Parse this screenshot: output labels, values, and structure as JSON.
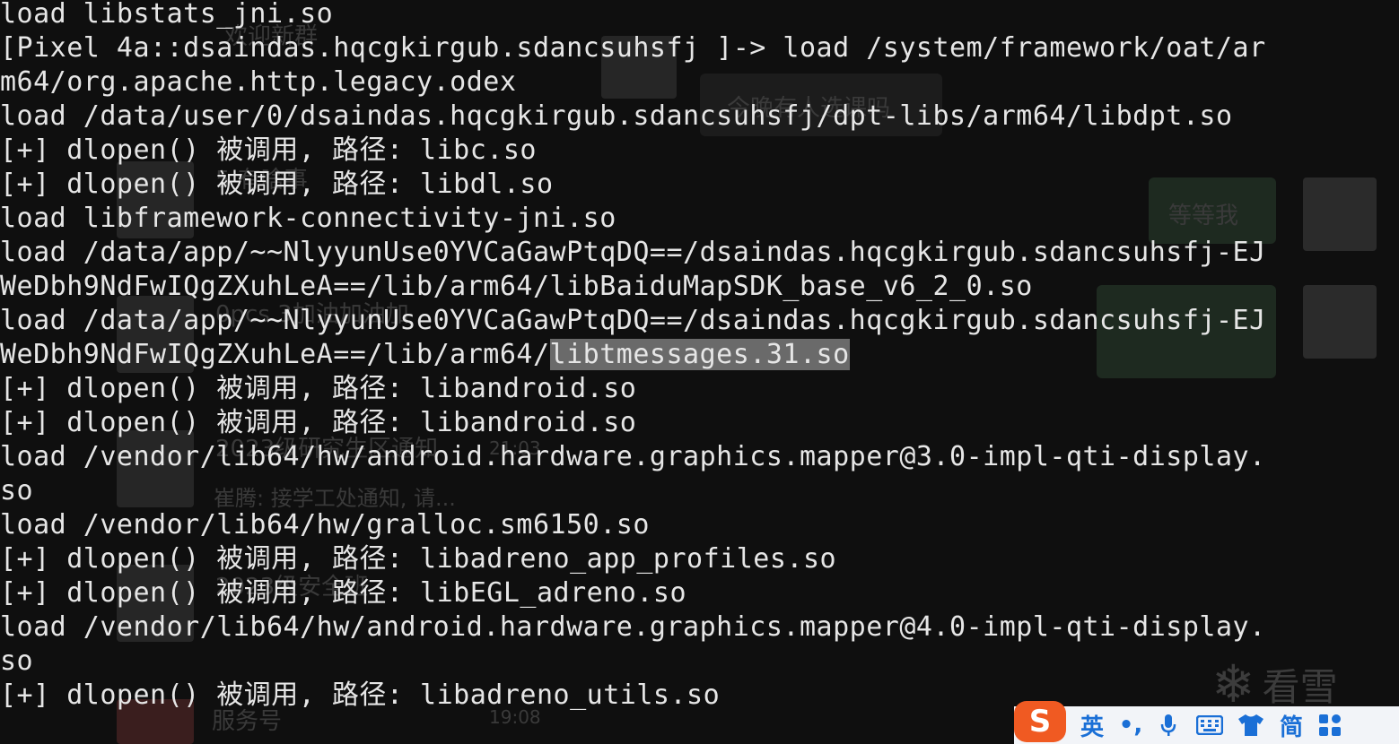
{
  "terminal": {
    "lines": [
      "load libstats_jni.so",
      "[Pixel 4a::dsaindas.hqcgkirgub.sdancsuhsfj ]-> load /system/framework/oat/ar",
      "m64/org.apache.http.legacy.odex",
      "load /data/user/0/dsaindas.hqcgkirgub.sdancsuhsfj/dpt-libs/arm64/libdpt.so",
      "[+] dlopen() 被调用, 路径: libc.so",
      "[+] dlopen() 被调用, 路径: libdl.so",
      "load libframework-connectivity-jni.so",
      "load /data/app/~~NlyyunUse0YVCaGawPtqDQ==/dsaindas.hqcgkirgub.sdancsuhsfj-EJ",
      "WeDbh9NdFwIQgZXuhLeA==/lib/arm64/libBaiduMapSDK_base_v6_2_0.so",
      "load /data/app/~~NlyyunUse0YVCaGawPtqDQ==/dsaindas.hqcgkirgub.sdancsuhsfj-EJ",
      "WeDbh9NdFwIQgZXuhLeA==/lib/arm64/",
      "[+] dlopen() 被调用, 路径: libandroid.so",
      "[+] dlopen() 被调用, 路径: libandroid.so",
      "load /vendor/lib64/hw/android.hardware.graphics.mapper@3.0-impl-qti-display.",
      "so",
      "load /vendor/lib64/hw/gralloc.sm6150.so",
      "[+] dlopen() 被调用, 路径: libadreno_app_profiles.so",
      "[+] dlopen() 被调用, 路径: libEGL_adreno.so",
      "load /vendor/lib64/hw/android.hardware.graphics.mapper@4.0-impl-qti-display.",
      "so",
      "[+] dlopen() 被调用, 路径: libadreno_utils.so"
    ],
    "selected_text": "libtmessages.31.so"
  },
  "background_chat": {
    "group_1": "欢迎新群",
    "msg_1": "今晚有人选课吗",
    "msg_2": "等等我",
    "item_2": "5 有啥事",
    "item_3": "0pcs 3加油加油加",
    "item_4_title": "2023级研究生区通知",
    "item_4_time": "21:03",
    "item_4_sub": "崔腾: 接学工处通知, 请...",
    "item_5": "2023级安全班",
    "item_6": "服务号",
    "item_6_time": "19:08"
  },
  "watermark": {
    "text": "看雪"
  },
  "ime": {
    "logo": "S",
    "lang": "英",
    "punct": "•,",
    "simp": "简"
  },
  "colors": {
    "background": "#0f0f0f",
    "text": "#e6e6e6",
    "selection": "#6a6a6a",
    "ime_accent": "#1a6fd6",
    "ime_logo": "#f05a22"
  }
}
